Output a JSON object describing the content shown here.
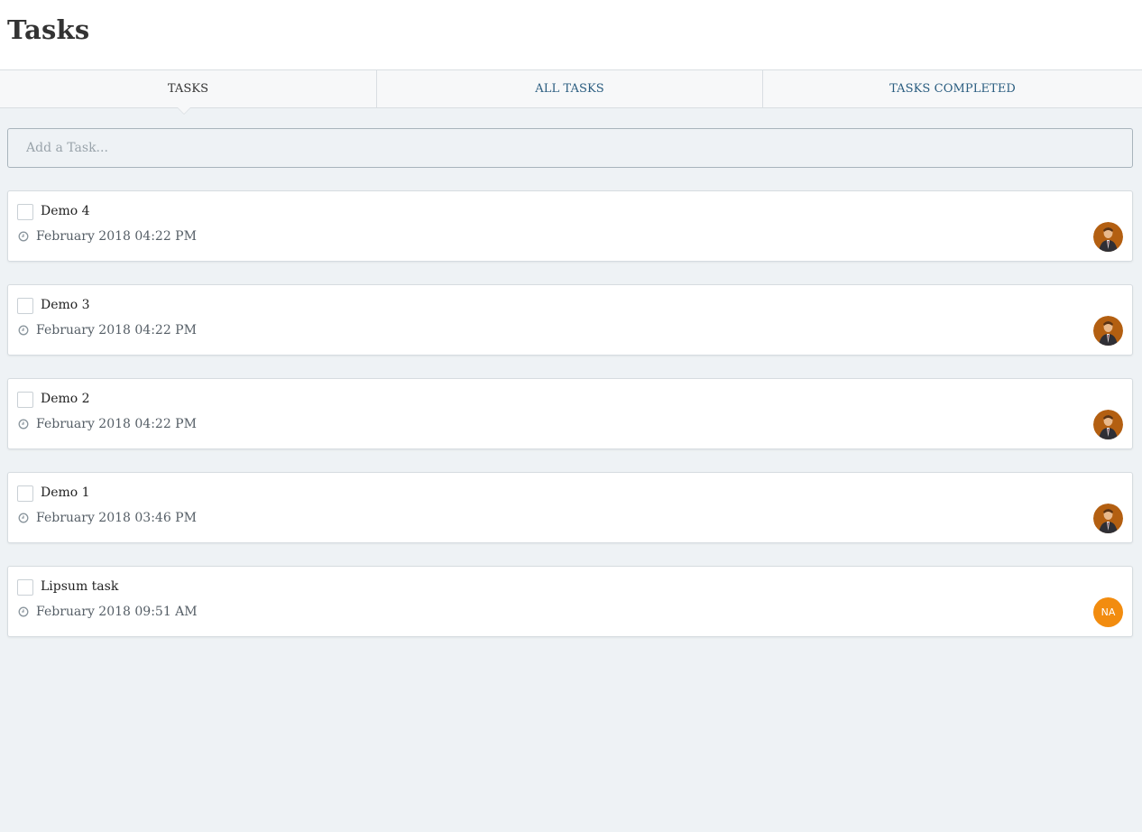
{
  "header": {
    "title": "Tasks"
  },
  "tabs": [
    {
      "label": "TASKS",
      "active": true
    },
    {
      "label": "ALL TASKS",
      "active": false
    },
    {
      "label": "TASKS COMPLETED",
      "active": false
    }
  ],
  "add_task": {
    "placeholder": "Add a Task..."
  },
  "tasks": [
    {
      "title": "Demo 4",
      "date": "February 2018 04:22 PM",
      "avatar": "photo",
      "checked": false
    },
    {
      "title": "Demo 3",
      "date": "February 2018 04:22 PM",
      "avatar": "photo",
      "checked": false
    },
    {
      "title": "Demo 2",
      "date": "February 2018 04:22 PM",
      "avatar": "photo",
      "checked": false
    },
    {
      "title": "Demo 1",
      "date": "February 2018 03:46 PM",
      "avatar": "photo",
      "checked": false
    },
    {
      "title": "Lipsum task",
      "date": "February 2018 09:51 AM",
      "avatar": "initials",
      "initials": "NA",
      "checked": false
    }
  ],
  "colors": {
    "background": "#eef2f5",
    "tab_link": "#2a5d80",
    "avatar_initials_bg": "#f28c0f"
  },
  "icons": {
    "date": "clock-icon",
    "avatar_photo": "user-photo-avatar"
  }
}
